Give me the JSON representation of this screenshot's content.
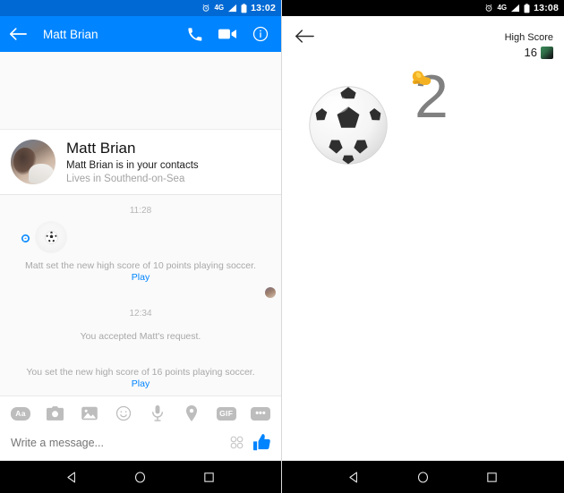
{
  "left_phone": {
    "status_bar": {
      "alarm_icon": "alarm-clock-icon",
      "network": "4G",
      "signal_icon": "signal-bars-icon",
      "battery_icon": "battery-icon",
      "time": "13:02",
      "bg_color": "#0069d4"
    },
    "header": {
      "back_icon": "back-arrow-icon",
      "title": "Matt Brian",
      "call_icon": "phone-call-icon",
      "video_icon": "video-camera-icon",
      "info_icon": "info-circle-icon",
      "bg_color": "#0084ff"
    },
    "profile_card": {
      "avatar": "contact-avatar",
      "name": "Matt Brian",
      "contact_status": "Matt Brian is in your contacts",
      "location": "Lives in Southend-on-Sea"
    },
    "thread": [
      {
        "timestamp": "11:28",
        "sender_avatar": "matt-avatar",
        "badge_icon": "messenger-badge-icon",
        "bubble_icon": "soccer-ball-icon",
        "score_text": "Matt set the new high score of 10 points playing soccer.",
        "play_label": "Play",
        "read_receipt_avatar": "read-receipt-avatar"
      },
      {
        "timestamp": "12:34",
        "accepted_text": "You accepted Matt's request.",
        "score_text": "You set the new high score of 16 points playing soccer.",
        "play_label": "Play"
      }
    ],
    "composer": {
      "tools": [
        {
          "name": "text-format-icon",
          "label": "Aa"
        },
        {
          "name": "camera-icon",
          "label": ""
        },
        {
          "name": "photo-gallery-icon",
          "label": ""
        },
        {
          "name": "emoji-smiley-icon",
          "label": ""
        },
        {
          "name": "microphone-icon",
          "label": ""
        },
        {
          "name": "location-pin-icon",
          "label": ""
        },
        {
          "name": "gif-icon",
          "label": "GIF"
        },
        {
          "name": "more-options-icon",
          "label": "•••"
        }
      ],
      "input_placeholder": "Write a message...",
      "input_value": "",
      "stickers_icon": "stickers-grid-icon",
      "like_icon": "thumbs-up-icon",
      "like_color": "#0084ff"
    },
    "nav_bar": {
      "back": "nav-back-triangle",
      "home": "nav-home-circle",
      "recents": "nav-recents-square"
    }
  },
  "right_phone": {
    "status_bar": {
      "alarm_icon": "alarm-clock-icon",
      "network": "4G",
      "signal_icon": "signal-bars-icon",
      "battery_icon": "battery-icon",
      "time": "13:08",
      "bg_color": "#000000"
    },
    "header": {
      "back_icon": "back-arrow-icon",
      "high_score_label": "High Score",
      "high_score_value": "16",
      "high_score_avatar": "high-score-avatar"
    },
    "stage": {
      "ball_icon": "soccer-ball-icon",
      "counter_value": "2",
      "bicep_icon": "flexed-bicep-icon",
      "counter_color": "#808080"
    },
    "nav_bar": {
      "back": "nav-back-triangle",
      "home": "nav-home-circle",
      "recents": "nav-recents-square"
    }
  }
}
